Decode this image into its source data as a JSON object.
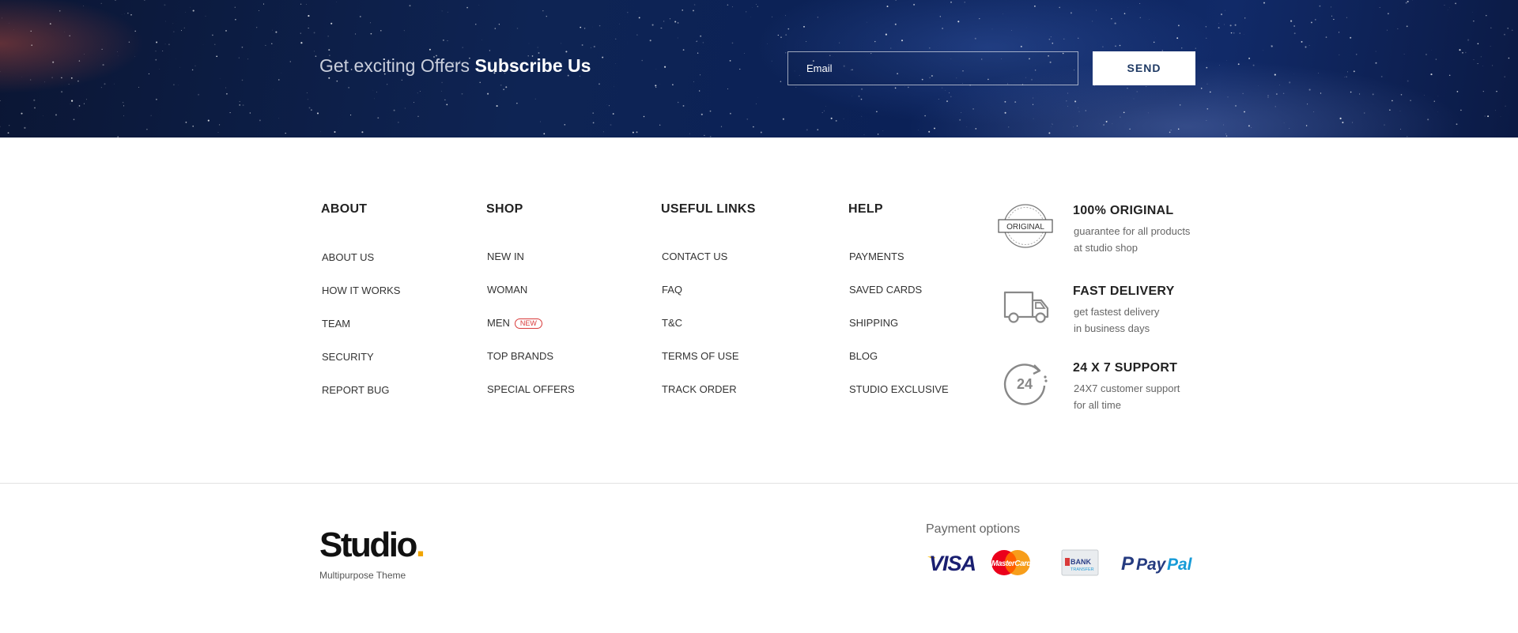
{
  "subscribe": {
    "title_light": "Get exciting Offers",
    "title_bold": "Subscribe Us",
    "email_placeholder": "Email",
    "send_label": "SEND"
  },
  "columns": [
    {
      "heading": "ABOUT",
      "items": [
        "ABOUT US",
        "HOW IT WORKS",
        "TEAM",
        "SECURITY",
        "REPORT BUG"
      ]
    },
    {
      "heading": "SHOP",
      "items": [
        "NEW IN",
        "WOMAN",
        "MEN",
        "TOP BRANDS",
        "SPECIAL OFFERS"
      ],
      "badge": "NEW"
    },
    {
      "heading": "USEFUL LINKS",
      "items": [
        "CONTACT US",
        "FAQ",
        "T&C",
        "TERMS OF USE",
        "TRACK ORDER"
      ]
    },
    {
      "heading": "HELP",
      "items": [
        "PAYMENTS",
        "SAVED CARDS",
        "SHIPPING",
        "BLOG",
        "STUDIO EXCLUSIVE"
      ]
    }
  ],
  "features": [
    {
      "icon": "original-seal-icon",
      "icon_text": "ORIGINAL",
      "title": "100% ORIGINAL",
      "line1": "guarantee for all products",
      "line2": "at studio shop"
    },
    {
      "icon": "delivery-truck-icon",
      "title": "FAST DELIVERY",
      "line1": "get fastest delivery",
      "line2": "in business days"
    },
    {
      "icon": "support-24-icon",
      "icon_text": "24",
      "title": "24 X 7 SUPPORT",
      "line1": "24X7 customer support",
      "line2": "for all time"
    }
  ],
  "brand": {
    "name": "Studio",
    "dot": ".",
    "tagline": "Multipurpose Theme"
  },
  "payments": {
    "title": "Payment options",
    "visa": "VISA",
    "mastercard": "MasterCard",
    "bank_1": "BANK",
    "bank_2": "TRANSFER",
    "paypal_1": "Pay",
    "paypal_2": "Pal",
    "paypal_p": "P"
  },
  "colors": {
    "banner_bg": "#0e2454",
    "send_text": "#1f3a64",
    "new_badge": "#d93a3a",
    "logo_dot": "#f0a500",
    "visa_blue": "#1a1f71",
    "paypal_dark": "#253b80",
    "paypal_light": "#179bd7"
  }
}
